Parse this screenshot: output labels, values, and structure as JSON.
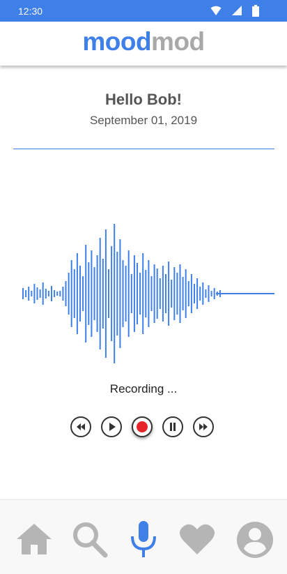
{
  "status_bar": {
    "time": "12:30"
  },
  "app_bar": {
    "logo_part1": "mood",
    "logo_part2": "mod",
    "accent": "#3f7fe8",
    "muted": "#a9a9a9"
  },
  "greeting": {
    "title": "Hello Bob!",
    "date": "September 01, 2019"
  },
  "recorder": {
    "status": "Recording ...",
    "controls": [
      "rewind-icon",
      "play-icon",
      "record-icon",
      "pause-icon",
      "fast-forward-icon"
    ],
    "record_color": "#e8242b"
  },
  "bottom_nav": {
    "items": [
      "home-icon",
      "search-icon",
      "microphone-icon",
      "heart-icon",
      "account-icon"
    ],
    "active": "microphone-icon",
    "inactive_color": "#b5b5b5"
  }
}
